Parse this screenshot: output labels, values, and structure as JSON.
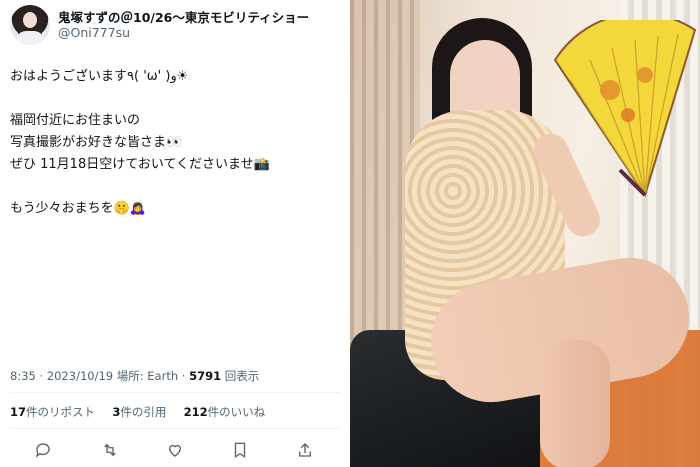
{
  "author": {
    "display_name": "鬼塚すずの＠10/26〜東京モビリティショー",
    "handle": "@Oni777su"
  },
  "tweet": {
    "lines": [
      "おはようございます٩( 'ω' )و☀",
      "",
      "福岡付近にお住まいの",
      "写真撮影がお好きな皆さま👀",
      "ぜひ 11月18日空けておいてくださいませ📸",
      "",
      "もう少々おまちを🤫🙇‍♀️"
    ]
  },
  "meta": {
    "time": "8:35",
    "date": "2023/10/19",
    "place": "場所: Earth",
    "views_count": "5791",
    "views_label": "回表示"
  },
  "stats": {
    "retweets_count": "17",
    "retweets_label": "件のリポスト",
    "quotes_count": "3",
    "quotes_label": "件の引用",
    "likes_count": "212",
    "likes_label": "件のいいね"
  },
  "icons": {
    "reply": "reply-icon",
    "retweet": "retweet-icon",
    "like": "heart-icon",
    "bookmark": "bookmark-icon",
    "share": "share-icon"
  },
  "colors": {
    "text": "#0f1419",
    "secondary": "#536471",
    "divider": "#eff3f4",
    "fan": "#f4d73a"
  }
}
